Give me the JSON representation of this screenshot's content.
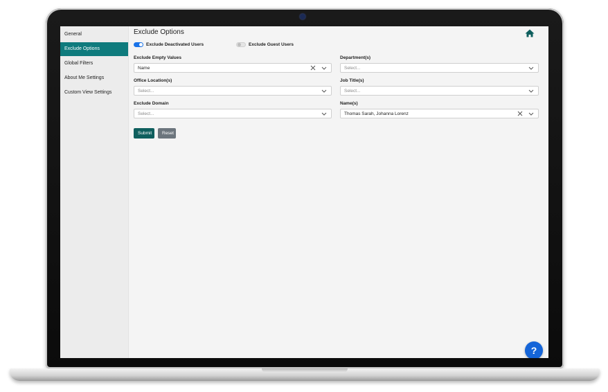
{
  "sidebar": {
    "items": [
      {
        "label": "General"
      },
      {
        "label": "Exclude Options"
      },
      {
        "label": "Global Filters"
      },
      {
        "label": "About Me Settings"
      },
      {
        "label": "Custom View Settings"
      }
    ]
  },
  "page": {
    "title": "Exclude Options"
  },
  "toggles": {
    "deactivated": {
      "label": "Exclude Deactivated Users",
      "on": true
    },
    "guest": {
      "label": "Exclude Guest Users",
      "on": false
    }
  },
  "fields": {
    "empty_values": {
      "label": "Exclude Empty Values",
      "value": "Name"
    },
    "department": {
      "label": "Department(s)",
      "placeholder": "Select..."
    },
    "office_location": {
      "label": "Office Location(s)",
      "placeholder": "Select..."
    },
    "job_title": {
      "label": "Job Title(s)",
      "placeholder": "Select..."
    },
    "domain": {
      "label": "Exclude Domain",
      "placeholder": "Select..."
    },
    "names": {
      "label": "Name(s)",
      "value": "Thomas Sarah, Johanna Lorenz"
    }
  },
  "buttons": {
    "submit": "Submit",
    "reset": "Reset"
  },
  "help": {
    "label": "?"
  },
  "colors": {
    "accent": "#0f7b7d",
    "submit": "#0f5f5e",
    "reset": "#6c757d",
    "toggle_on": "#1a73e8",
    "help": "#1565d8"
  },
  "icons": [
    "home-icon",
    "clear-icon",
    "chevron-down-icon",
    "help-icon"
  ]
}
